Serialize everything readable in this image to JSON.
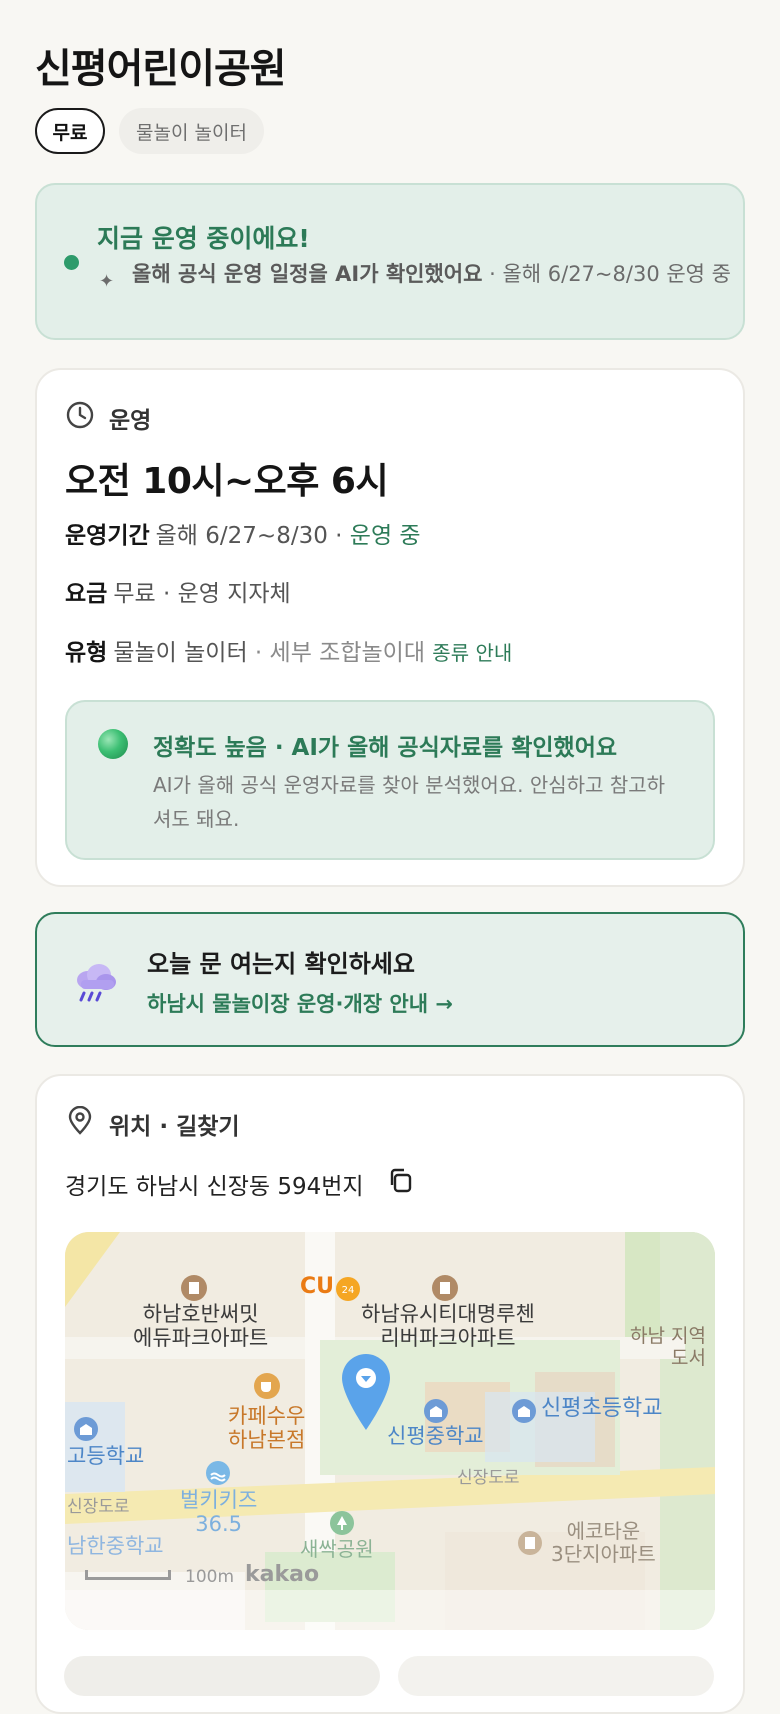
{
  "title": "신평어린이공원",
  "chips": {
    "free": "무료",
    "type": "물놀이 놀이터"
  },
  "status": {
    "headline": "지금 운영 중이에요!",
    "ai_check": "올해 공식 운영 일정을 AI가 확인했어요",
    "period": " · 올해 6/27~8/30 운영 중"
  },
  "hours": {
    "section": "운영",
    "time": "오전 10시~오후 6시",
    "period_label": "운영기간",
    "period_value": "올해 6/27~8/30 · ",
    "period_status": "운영 중",
    "fee_label": "요금",
    "fee_value": "무료 · 운영 지자체",
    "type_label": "유형",
    "type_value": "물놀이 놀이터",
    "type_detail": " · 세부 조합놀이대 ",
    "type_link": "종류 안내"
  },
  "accuracy": {
    "title": "정확도 높음 · AI가 올해 공식자료를 확인했어요",
    "body": "AI가 올해 공식 운영자료를 찾아 분석했어요. 안심하고 참고하셔도 돼요."
  },
  "notice": {
    "title": "오늘 문 여는지 확인하세요",
    "link": "하남시 물놀이장 운영·개장 안내 →"
  },
  "location": {
    "section": "위치 · 길찾기",
    "address": "경기도 하남시 신장동 594번지"
  },
  "map": {
    "labels": {
      "apt1": "하남호반써밋\n에듀파크아파트",
      "cu": "CU",
      "apt2": "하남유시티대명루첸\n리버파크아파트",
      "region": "하남 지역\n도서",
      "cafe": "카페수우\n하남본점",
      "middle": "신평중학교",
      "elem": "신평초등학교",
      "high": "고등학교",
      "road1": "신장도로",
      "road2": "신장도로",
      "kids": "벌키키즈\n36.5",
      "south": "남한중학교",
      "park": "새싹공원",
      "eco": "에코타운\n3단지아파트",
      "scale": "100m",
      "brand": "kakao"
    }
  }
}
